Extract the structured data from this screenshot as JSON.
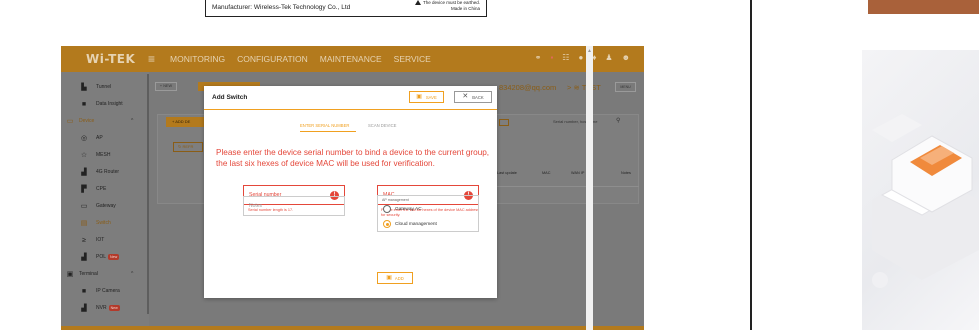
{
  "label": {
    "manufacturer": "Manufacturer: Wireless-Tek Technology Co., Ltd",
    "earth_warning": "The device must be earthed.",
    "made_in": "Made in China"
  },
  "app": {
    "logo": "Wi-TEK",
    "nav": [
      "MONITORING",
      "CONFIGURATION",
      "MAINTENANCE",
      "SERVICE"
    ],
    "sidebar": {
      "items_top": [
        {
          "label": "Tunnel",
          "icon": "tunnel-icon"
        },
        {
          "label": "Data Insight",
          "icon": "data-insight-icon"
        }
      ],
      "device_group": "Device",
      "device_items": [
        {
          "label": "AP",
          "icon": "ap-icon"
        },
        {
          "label": "MESH",
          "icon": "mesh-icon"
        },
        {
          "label": "4G Router",
          "icon": "router-icon"
        },
        {
          "label": "CPE",
          "icon": "cpe-icon"
        },
        {
          "label": "Gateway",
          "icon": "gateway-icon"
        },
        {
          "label": "Switch",
          "icon": "switch-icon"
        },
        {
          "label": "IOT",
          "icon": "iot-icon"
        },
        {
          "label": "POL",
          "icon": "pol-icon",
          "badge": "New"
        }
      ],
      "terminal_group": "Terminal",
      "terminal_items": [
        {
          "label": "IP Camera",
          "icon": "camera-icon"
        },
        {
          "label": "NVR",
          "icon": "nvr-icon",
          "badge": "New"
        }
      ]
    },
    "background": {
      "new_btn": "+ NEW",
      "add_btn": "+ ADD DE",
      "refresh_btn": "REFR",
      "account_email": "834208@qq.com",
      "wifi_label": "TEST",
      "right_btn": "MENU",
      "search_placeholder": "Serial number, hostname",
      "table_headers": [
        "No",
        "Last update",
        "MAC",
        "WAN IP",
        "Notes"
      ]
    }
  },
  "modal": {
    "title": "Add Switch",
    "save_label": "SAVE",
    "back_label": "BACK",
    "tabs": {
      "active": "ENTER SERIAL NUMBER",
      "inactive": "SCAN DEVICE"
    },
    "instruction": "Please enter the device serial number to bind a device to the current group, the last six hexes of device MAC will be used for verification.",
    "serial_placeholder": "Serial number",
    "serial_error": "Serial number length is 17.",
    "mac_placeholder": "MAC",
    "mac_error": "Please enter the last six hexes of the device MAC address for security.",
    "notes_placeholder": "Notes",
    "ap_management_label": "AP management",
    "radio_options": [
      {
        "label": "Gateway AC",
        "checked": false
      },
      {
        "label": "Cloud management",
        "checked": true
      }
    ],
    "add_label": "ADD"
  },
  "colors": {
    "accent": "#f0a020",
    "error": "#e4473a",
    "topbar": "#b37a1d",
    "overlay": "#7a7a7a",
    "brown_bar": "#a9613a"
  }
}
